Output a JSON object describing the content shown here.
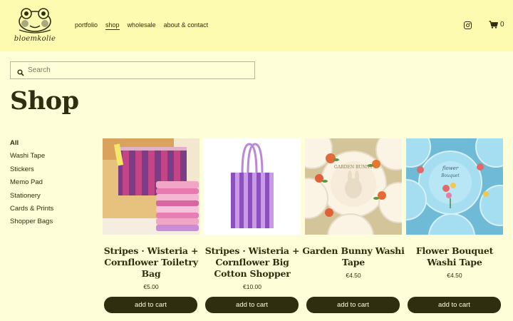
{
  "header": {
    "logo_text": "bloemkolie",
    "nav": [
      "portfolio",
      "shop",
      "wholesale",
      "about & contact"
    ],
    "active_nav": "shop",
    "cart_count": "0"
  },
  "search": {
    "placeholder": "Search"
  },
  "page_title": "Shop",
  "categories": [
    "All",
    "Washi Tape",
    "Stickers",
    "Memo Pad",
    "Stationery",
    "Cards & Prints",
    "Shopper Bags"
  ],
  "active_category": "All",
  "products": [
    {
      "name": "Stripes · Wisteria + Cornflower Toiletry Bag",
      "price": "€5.00",
      "button": "add to cart"
    },
    {
      "name": "Stripes · Wisteria + Cornflower Big Cotton Shopper",
      "price": "€10.00",
      "button": "add to cart"
    },
    {
      "name": "Garden Bunny Washi Tape",
      "price": "€4.50",
      "button": "add to cart"
    },
    {
      "name": "Flower Bouquet Washi Tape",
      "price": "€4.50",
      "button": "add to cart"
    }
  ],
  "colors": {
    "header_bg": "#fdfbb0",
    "page_bg": "#fefed8",
    "button_bg": "#2f2e0f"
  },
  "icons": {
    "social": "instagram-icon",
    "cart": "cart-icon",
    "search": "search-icon"
  }
}
